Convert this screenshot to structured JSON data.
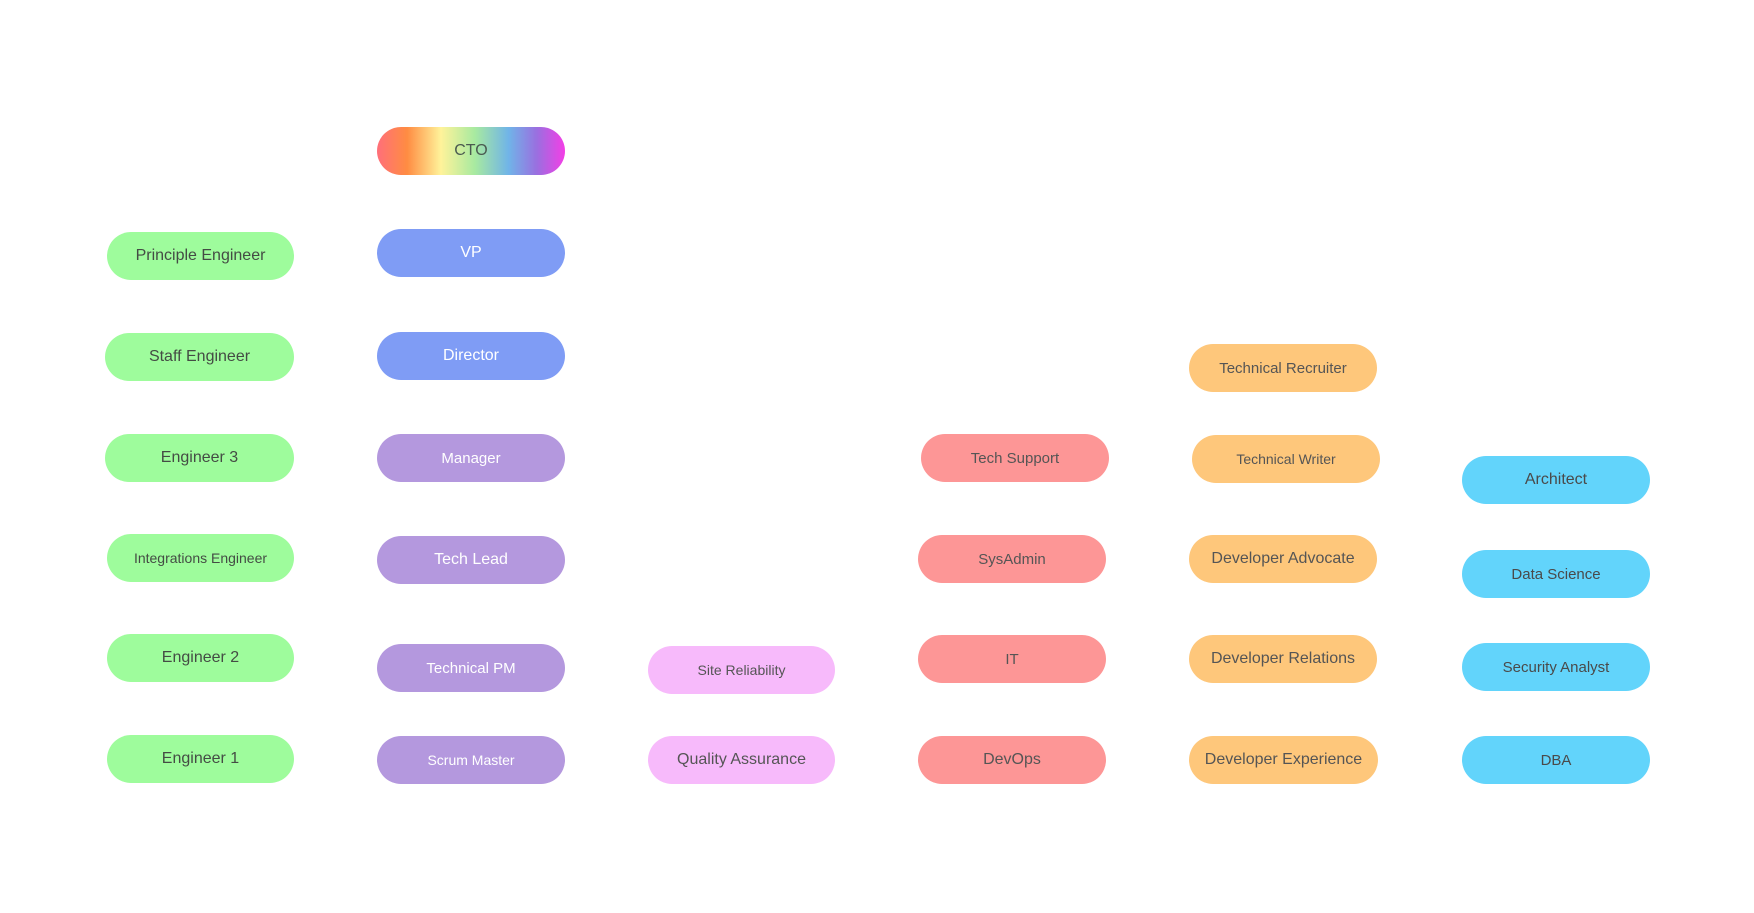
{
  "nodes": {
    "cto": "CTO",
    "vp": "VP",
    "director": "Director",
    "manager": "Manager",
    "tech_lead": "Tech Lead",
    "technical_pm": "Technical PM",
    "scrum_master": "Scrum Master",
    "principle_engineer": "Principle Engineer",
    "staff_engineer": "Staff Engineer",
    "engineer_3": "Engineer 3",
    "integrations_engineer": "Integrations Engineer",
    "engineer_2": "Engineer 2",
    "engineer_1": "Engineer 1",
    "site_reliability": "Site Reliability",
    "quality_assurance": "Quality Assurance",
    "tech_support": "Tech Support",
    "sysadmin": "SysAdmin",
    "it": "IT",
    "devops": "DevOps",
    "technical_recruiter": "Technical Recruiter",
    "technical_writer": "Technical Writer",
    "developer_advocate": "Developer Advocate",
    "developer_relations": "Developer Relations",
    "developer_experience": "Developer Experience",
    "architect": "Architect",
    "data_science": "Data Science",
    "security_analyst": "Security Analyst",
    "dba": "DBA"
  },
  "colors": {
    "green": "#9efc9c",
    "blue": "#7f9cf5",
    "purple": "#b498de",
    "pink": "#f7bafb",
    "red": "#fd9696",
    "orange": "#fec77b",
    "cyan": "#62d4fb"
  }
}
